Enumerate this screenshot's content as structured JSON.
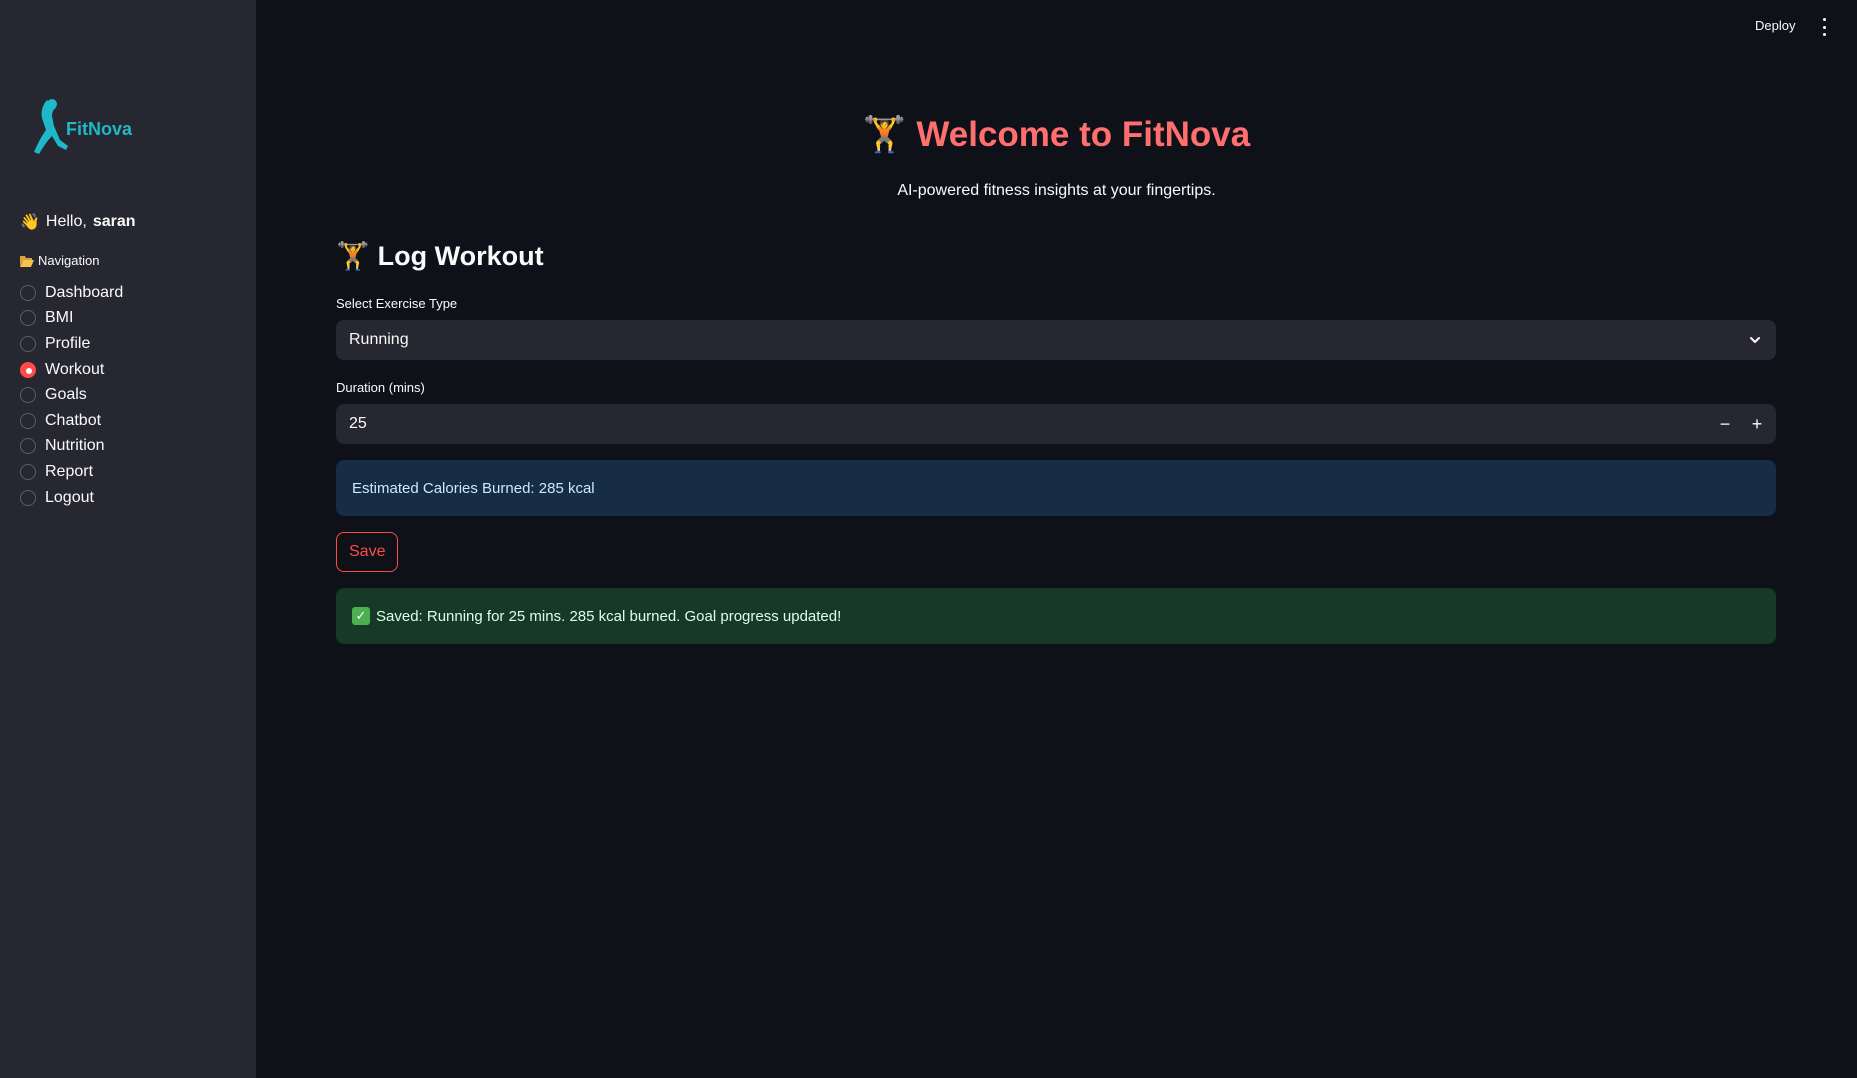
{
  "sidebar": {
    "logo_text": "FitNova",
    "greeting_prefix": "Hello,",
    "username": "saran",
    "nav_label": "Navigation",
    "items": [
      {
        "label": "Dashboard",
        "selected": false
      },
      {
        "label": "BMI",
        "selected": false
      },
      {
        "label": "Profile",
        "selected": false
      },
      {
        "label": "Workout",
        "selected": true
      },
      {
        "label": "Goals",
        "selected": false
      },
      {
        "label": "Chatbot",
        "selected": false
      },
      {
        "label": "Nutrition",
        "selected": false
      },
      {
        "label": "Report",
        "selected": false
      },
      {
        "label": "Logout",
        "selected": false
      }
    ]
  },
  "header": {
    "deploy_label": "Deploy",
    "menu_icon": "more-vertical-icon"
  },
  "main": {
    "title": "Welcome to FitNova",
    "subtitle": "AI-powered fitness insights at your fingertips.",
    "section_title": "Log Workout",
    "exercise": {
      "label": "Select Exercise Type",
      "value": "Running"
    },
    "duration": {
      "label": "Duration (mins)",
      "value": "25",
      "minus": "−",
      "plus": "+"
    },
    "info_message": "Estimated Calories Burned: 285 kcal",
    "save_label": "Save",
    "success_message": "Saved: Running for 25 mins. 285 kcal burned. Goal progress updated!"
  },
  "colors": {
    "accent": "#ff4b4b",
    "title": "#ff6f6f",
    "logo": "#1fb8c8",
    "info_bg": "#172d43",
    "success_bg": "#173928"
  },
  "icons": {
    "title": "weightlifter-icon",
    "section": "weightlifter-icon",
    "greeting": "waving-hand-icon",
    "nav": "open-folder-icon",
    "success": "check-mark-icon",
    "select": "chevron-down-icon"
  }
}
